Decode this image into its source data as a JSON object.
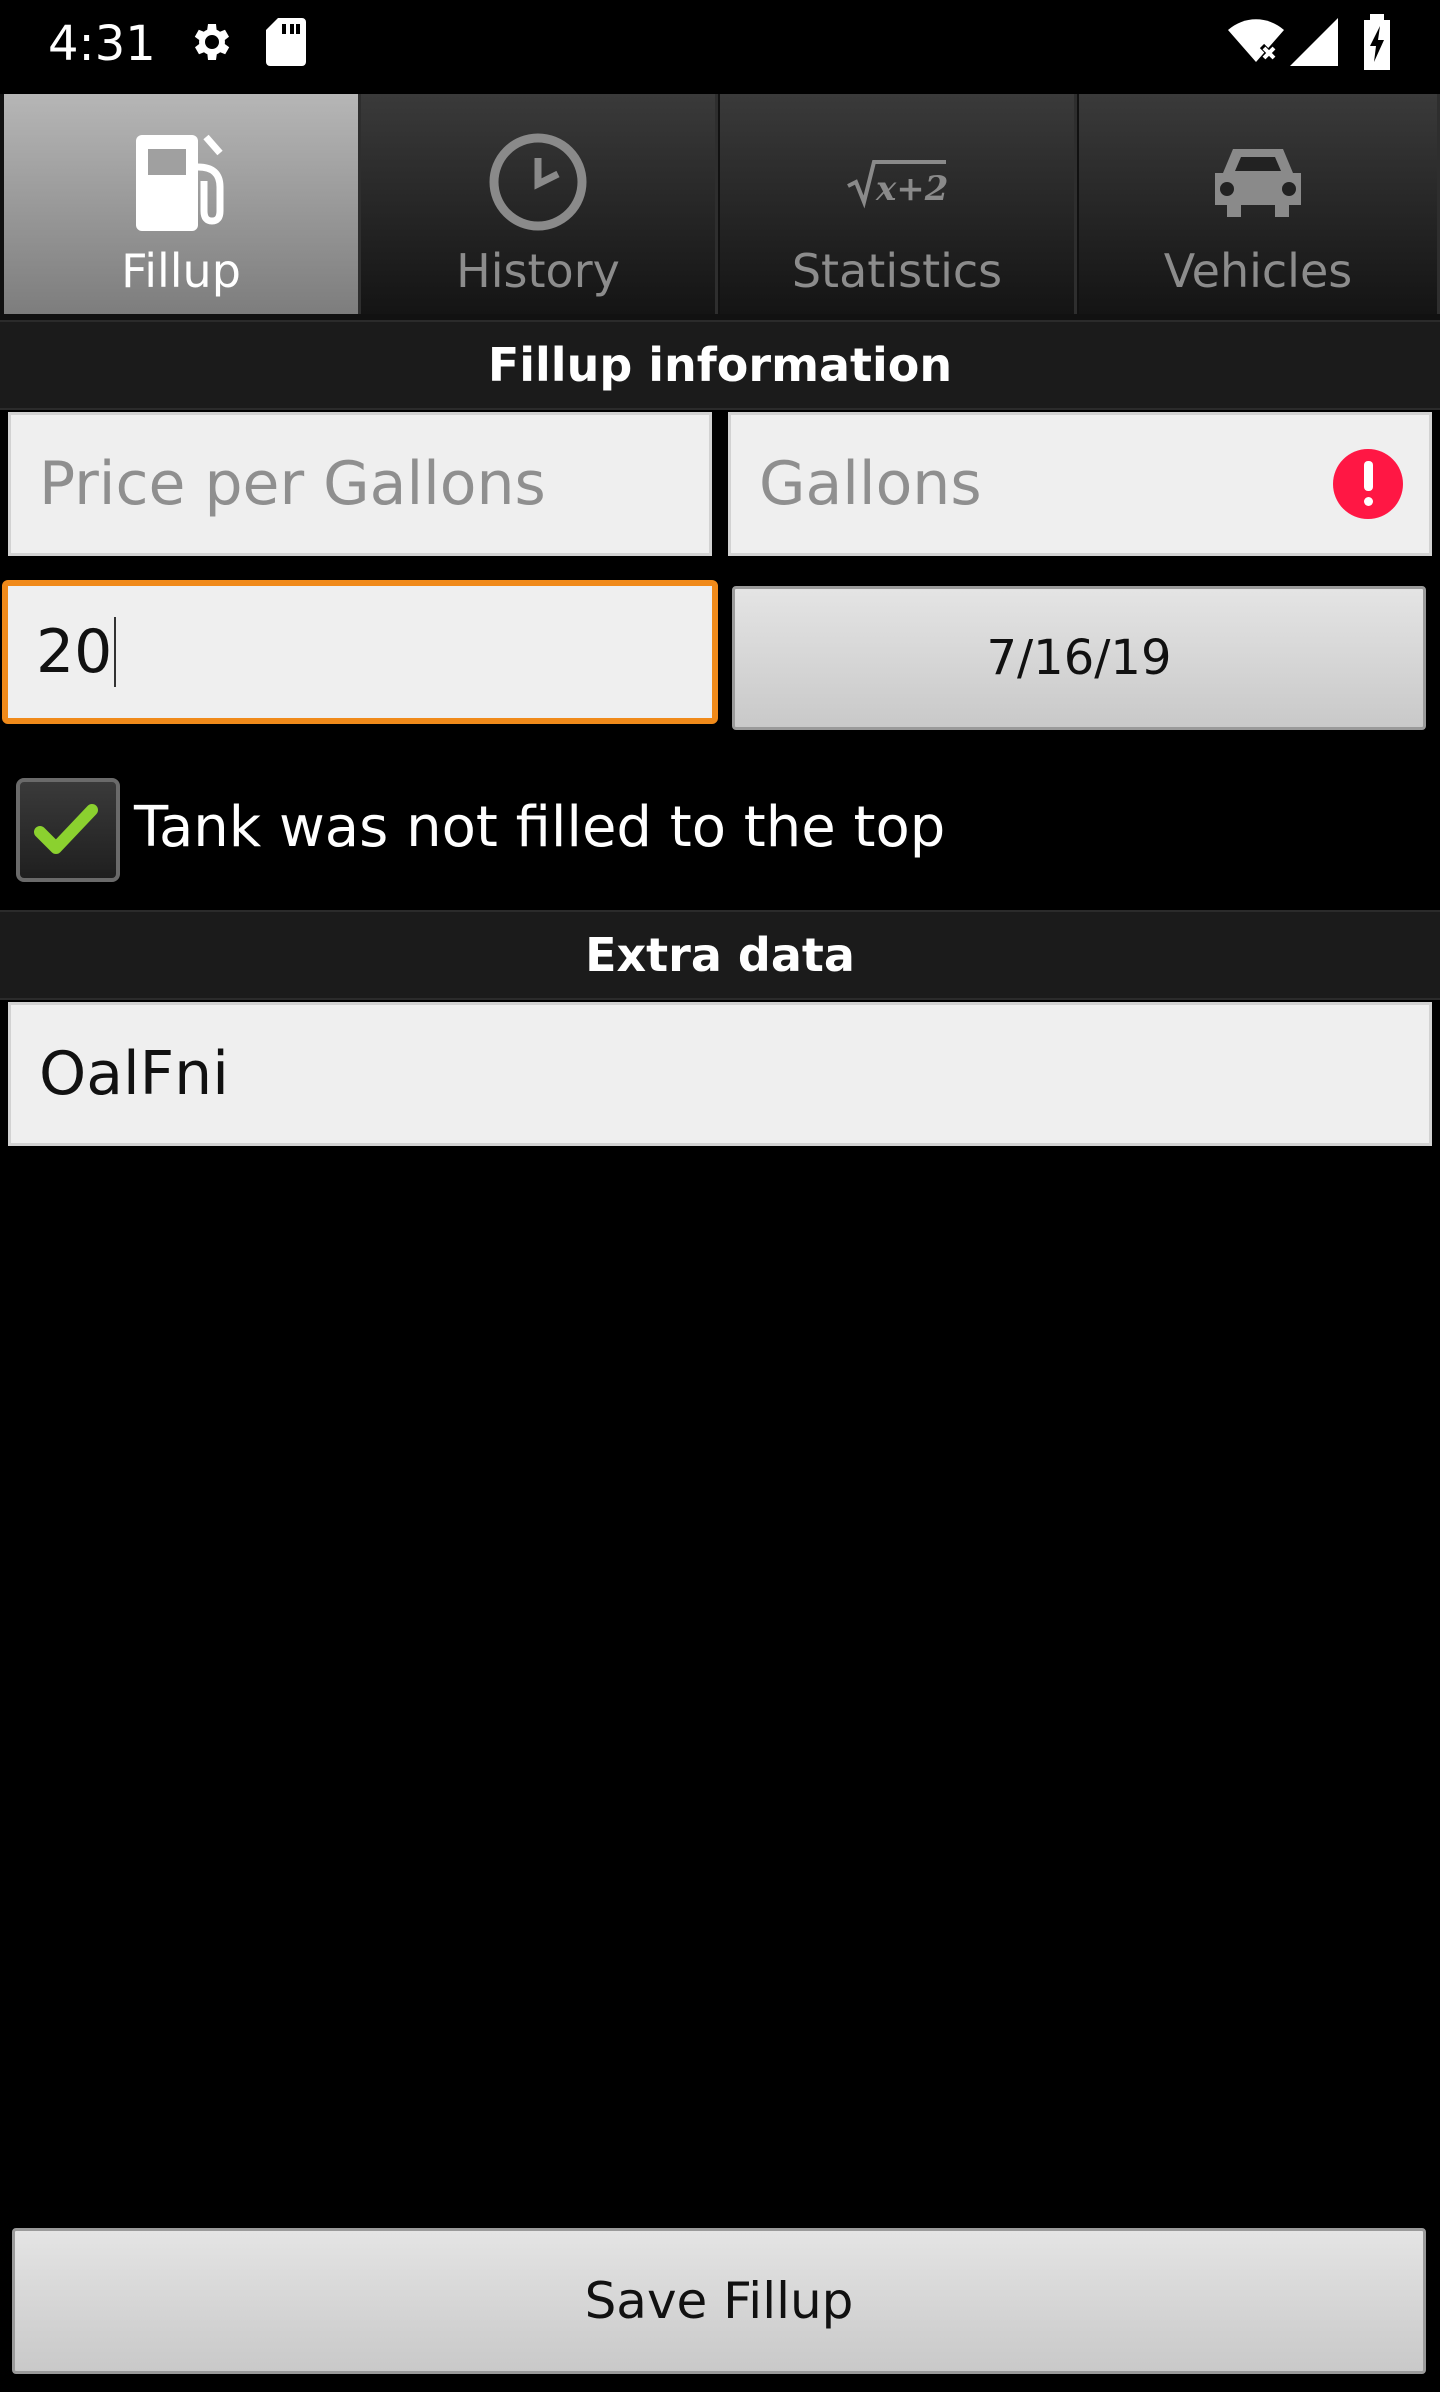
{
  "status_bar": {
    "time": "4:31"
  },
  "tabs": [
    {
      "label": "Fillup",
      "icon": "fuel-pump-icon",
      "active": true
    },
    {
      "label": "History",
      "icon": "clock-icon",
      "active": false
    },
    {
      "label": "Statistics",
      "icon": "sqrt-formula-icon",
      "active": false
    },
    {
      "label": "Vehicles",
      "icon": "car-icon",
      "active": false
    }
  ],
  "fillup_section": {
    "title": "Fillup information",
    "price_placeholder": "Price per Gallons",
    "gallons_placeholder": "Gallons",
    "odometer_value": "20",
    "date_value": "7/16/19",
    "partial_fill_label": "Tank was not filled to the top",
    "partial_fill_checked": true
  },
  "extra_section": {
    "title": "Extra data",
    "comment_value": "OalFni"
  },
  "save_button_label": "Save Fillup",
  "colors": {
    "focus_accent": "#f08a1a",
    "error": "#ff1744",
    "check": "#8bd12f"
  }
}
